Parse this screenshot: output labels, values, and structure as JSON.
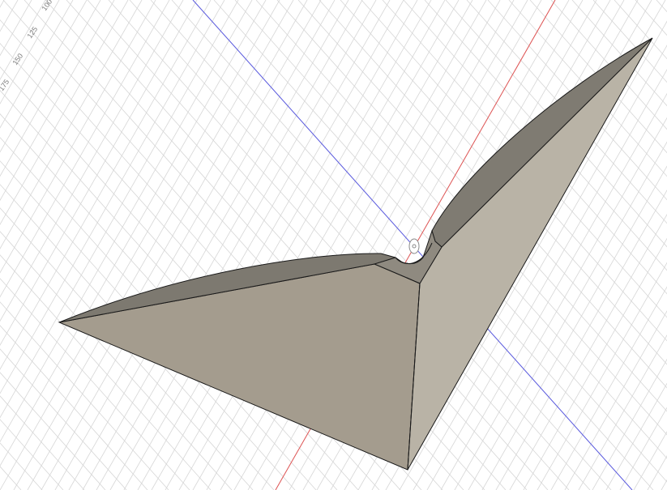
{
  "viewport": {
    "background_color": "#ffffff",
    "grid_color": "#d6d6d6",
    "axis_red_color": "#e05555",
    "axis_blue_color": "#5a5ae0"
  },
  "ruler": {
    "labels": [
      "100",
      "125",
      "150",
      "175"
    ]
  },
  "model": {
    "body_color_light": "#b7b1a4",
    "body_color_mid": "#a49c8e",
    "body_color_dark": "#7c786f",
    "edge_color": "#1a1a1a"
  },
  "origin": {
    "icon": "origin-point-icon"
  }
}
